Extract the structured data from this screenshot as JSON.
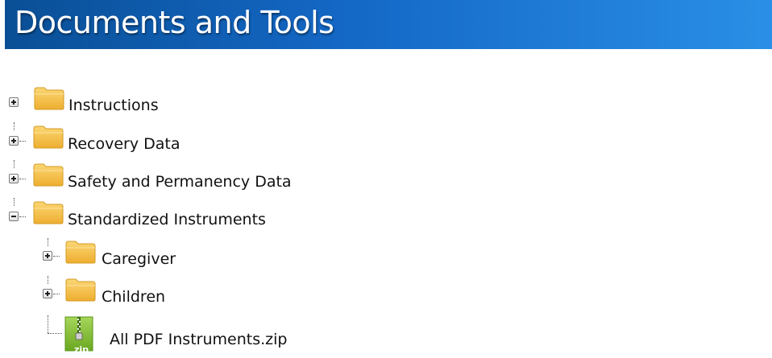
{
  "header": {
    "title": "Documents and Tools"
  },
  "colors": {
    "header_start": "#0a4f96",
    "header_end": "#2a8fe6",
    "folder_yellow": "#f5c24a",
    "zip_green": "#7cb82f"
  },
  "tree": {
    "items": [
      {
        "label": "Instructions",
        "type": "folder",
        "state": "collapsed",
        "icon": "folder-icon",
        "toggle_icon": "expand-plus-icon"
      },
      {
        "label": "Recovery Data",
        "type": "folder",
        "state": "collapsed",
        "icon": "folder-icon",
        "toggle_icon": "expand-plus-icon"
      },
      {
        "label": "Safety and Permanency Data",
        "type": "folder",
        "state": "collapsed",
        "icon": "folder-icon",
        "toggle_icon": "expand-plus-icon"
      },
      {
        "label": "Standardized Instruments",
        "type": "folder",
        "state": "expanded",
        "icon": "folder-icon",
        "toggle_icon": "collapse-minus-icon",
        "children": [
          {
            "label": "Caregiver",
            "type": "folder",
            "state": "collapsed",
            "icon": "folder-icon",
            "toggle_icon": "expand-plus-icon"
          },
          {
            "label": "Children",
            "type": "folder",
            "state": "collapsed",
            "icon": "folder-icon",
            "toggle_icon": "expand-plus-icon"
          },
          {
            "label": "All PDF Instruments.zip",
            "type": "file",
            "icon": "zip-file-icon",
            "icon_text": "zip"
          }
        ]
      }
    ]
  }
}
